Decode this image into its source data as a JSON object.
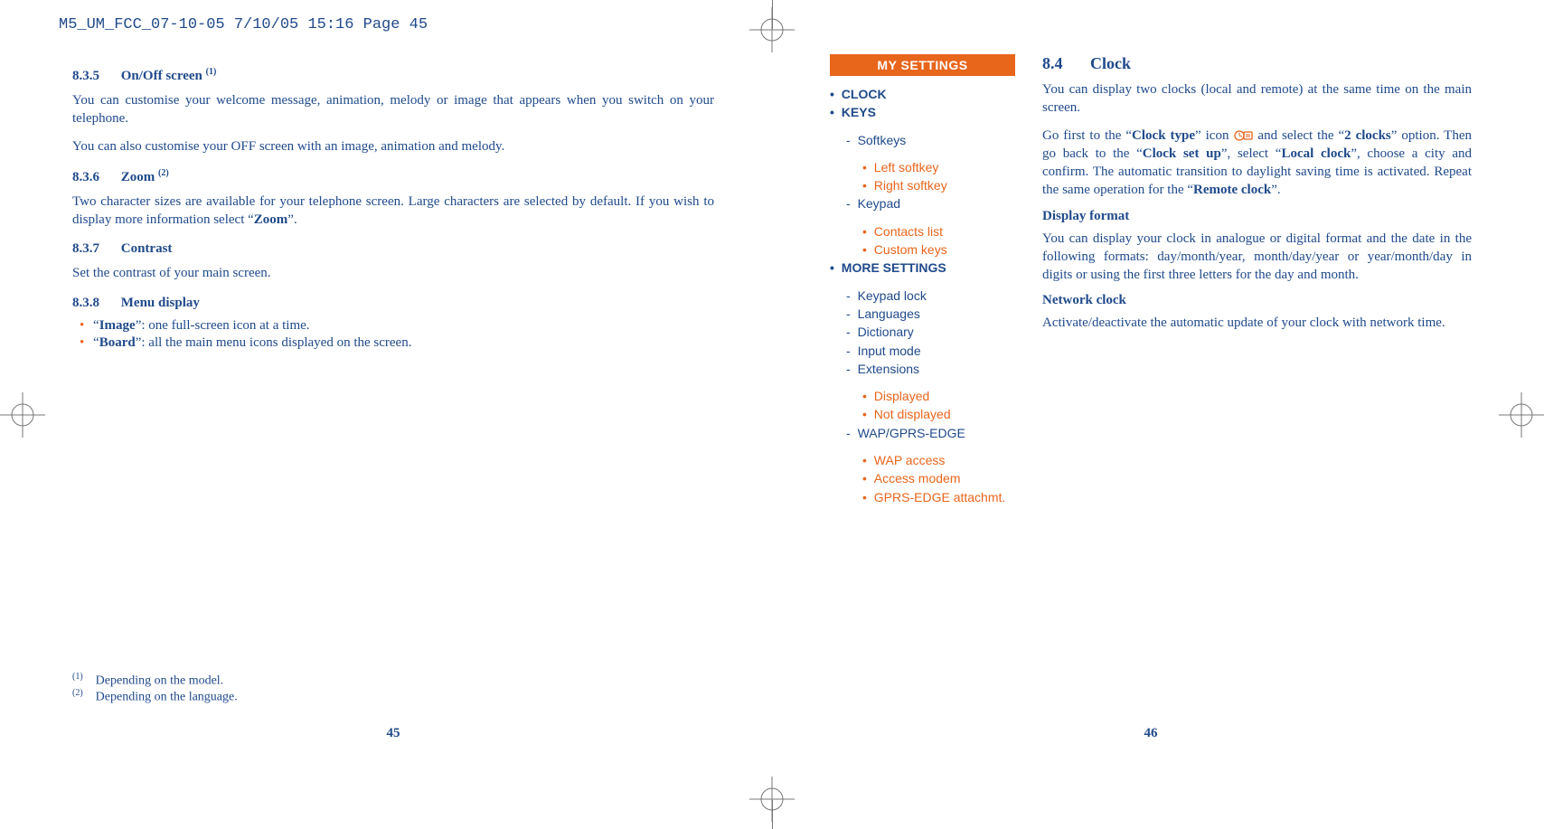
{
  "header_slug": "M5_UM_FCC_07-10-05  7/10/05  15:16  Page 45",
  "left_page": {
    "sections": [
      {
        "num": "8.3.5",
        "title_html": "On/Off screen <sup class='sup1'>(1)</sup>"
      },
      {
        "num": "8.3.6",
        "title_html": "Zoom <sup class='sup1'>(2)</sup>"
      },
      {
        "num": "8.3.7",
        "title_html": "Contrast"
      },
      {
        "num": "8.3.8",
        "title_html": "Menu display"
      }
    ],
    "p835a": "You can customise your welcome message, animation, melody or image that appears when you switch on your telephone.",
    "p835b": "You can also customise your OFF screen with an image, animation and melody.",
    "p836": "Two character sizes are available for your telephone screen. Large characters are selected by default. If you wish to display more information select “",
    "p836_bold": "Zoom",
    "p836_tail": "”.",
    "p837": "Set the contrast of your main screen.",
    "menu838": [
      {
        "label": "Image",
        "desc": "one full-screen icon at a time."
      },
      {
        "label": "Board",
        "desc": "all the main menu icons displayed on the screen."
      }
    ],
    "footnotes": [
      {
        "mark": "(1)",
        "text": "Depending on the model."
      },
      {
        "mark": "(2)",
        "text": "Depending on the language."
      }
    ],
    "page_num": "45"
  },
  "right_page": {
    "menu_title": "MY SETTINGS",
    "menu": [
      {
        "label": "CLOCK"
      },
      {
        "label": "KEYS",
        "children": [
          {
            "label": "Softkeys",
            "children": [
              {
                "label": "Left softkey"
              },
              {
                "label": "Right softkey"
              }
            ]
          },
          {
            "label": "Keypad",
            "children": [
              {
                "label": "Contacts list"
              },
              {
                "label": "Custom keys"
              }
            ]
          }
        ]
      },
      {
        "label": "MORE SETTINGS",
        "children": [
          {
            "label": "Keypad lock"
          },
          {
            "label": "Languages"
          },
          {
            "label": "Dictionary"
          },
          {
            "label": "Input mode"
          },
          {
            "label": "Extensions",
            "children": [
              {
                "label": "Displayed"
              },
              {
                "label": "Not displayed"
              }
            ]
          },
          {
            "label": "WAP/GPRS-EDGE",
            "children": [
              {
                "label": "WAP access"
              },
              {
                "label": "Access modem"
              },
              {
                "label": "GPRS-EDGE attachmt."
              }
            ]
          }
        ]
      }
    ],
    "section_num": "8.4",
    "section_title": "Clock",
    "p1": "You can display two clocks (local and remote) at the same time on the main screen.",
    "p2_parts": {
      "a": "Go first to the “",
      "b": "Clock type",
      "c": "” icon ",
      "d": " and select the “",
      "e": "2 clocks",
      "f": "” option. Then go back to the “",
      "g": "Clock set up",
      "h": "”, select “",
      "i": "Local clock",
      "j": "”, choose a city and confirm. The automatic transition to daylight saving time is activated. Repeat the same operation for the “",
      "k": "Remote clock",
      "l": "”."
    },
    "h_display": "Display format",
    "p_display": "You can display your clock in analogue or digital format and the date in the following formats: day/month/year, month/day/year or year/month/day in digits or using the first three letters for the day and month.",
    "h_network": "Network clock",
    "p_network": "Activate/deactivate the automatic update of your clock with network time.",
    "page_num": "46"
  }
}
